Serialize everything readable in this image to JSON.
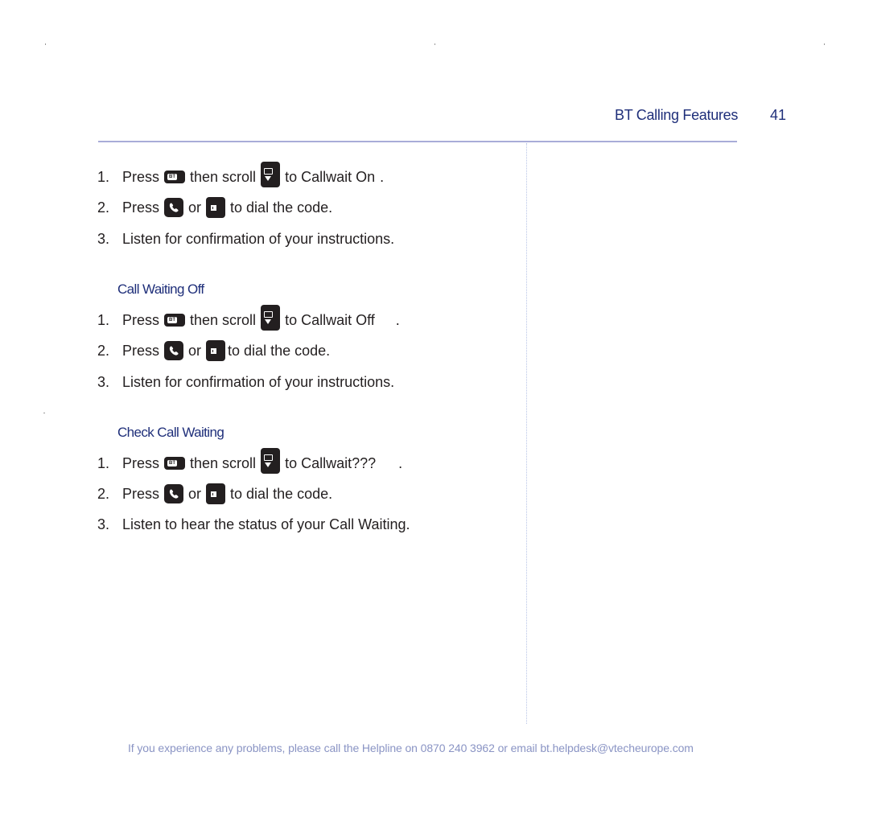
{
  "header": {
    "title": "BT Calling Features",
    "page_number": "41"
  },
  "sections": [
    {
      "heading": "",
      "steps": [
        {
          "num": "1.",
          "press": "Press",
          "then": "then scroll",
          "to": "to Callwait On",
          "end": "."
        },
        {
          "num": "2.",
          "press": "Press",
          "or": "or",
          "tail": "to dial the code."
        },
        {
          "num": "3.",
          "text": "Listen for confirmation of your instructions."
        }
      ]
    },
    {
      "heading": "Call Waiting Off",
      "steps": [
        {
          "num": "1.",
          "press": "Press",
          "then": "then scroll",
          "to": "to Callwait Off",
          "end": "."
        },
        {
          "num": "2.",
          "press": "Press",
          "or": "or",
          "tail": "to dial the code."
        },
        {
          "num": "3.",
          "text": "Listen for confirmation of your instructions."
        }
      ]
    },
    {
      "heading": "Check Call Waiting",
      "steps": [
        {
          "num": "1.",
          "press": "Press",
          "then": "then scroll",
          "to": "to Callwait???",
          "end": "."
        },
        {
          "num": "2.",
          "press": "Press",
          "or": "or",
          "tail": "to dial the code."
        },
        {
          "num": "3.",
          "text": "Listen to hear the status of your Call Waiting."
        }
      ]
    }
  ],
  "keys": {
    "bt_key_label": "BT",
    "icons": [
      "bt-menu-key-icon",
      "scroll-key-icon",
      "call-key-icon",
      "redial-key-icon"
    ]
  },
  "footer": {
    "text": "If you experience any problems, please call the Helpline on 0870 240 3962 or email bt.helpdesk@vtecheurope.com"
  },
  "colors": {
    "heading_blue": "#1f2f7a",
    "rule": "#a9acd8",
    "footer_text": "#8a94c4"
  }
}
